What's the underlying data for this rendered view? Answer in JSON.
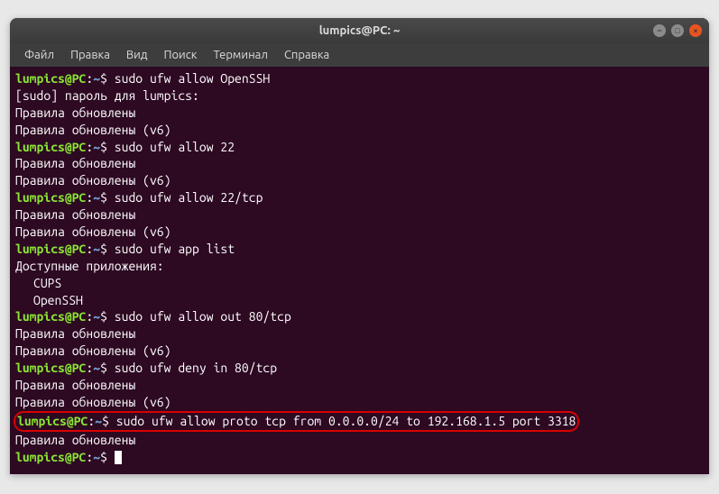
{
  "window": {
    "title": "lumpics@PC: ~"
  },
  "menubar": {
    "items": [
      "Файл",
      "Правка",
      "Вид",
      "Поиск",
      "Терминал",
      "Справка"
    ]
  },
  "terminal": {
    "prompt": {
      "user_host": "lumpics@PC",
      "colon": ":",
      "path": "~",
      "sigil": "$"
    },
    "commands": {
      "cmd1": "sudo ufw allow OpenSSH",
      "cmd2": "sudo ufw allow 22",
      "cmd3": "sudo ufw allow 22/tcp",
      "cmd4": "sudo ufw app list",
      "cmd5": "sudo ufw allow out 80/tcp",
      "cmd6": "sudo ufw deny in 80/tcp",
      "cmd7": "sudo ufw allow proto tcp from 0.0.0.0/24 to 192.168.1.5 port 3318"
    },
    "outputs": {
      "sudo_pass": "[sudo] пароль для lumpics:",
      "rules_updated": "Правила обновлены",
      "rules_updated_v6": "Правила обновлены (v6)",
      "apps_available": "Доступные приложения:",
      "app_cups": "CUPS",
      "app_openssh": "OpenSSH"
    }
  }
}
